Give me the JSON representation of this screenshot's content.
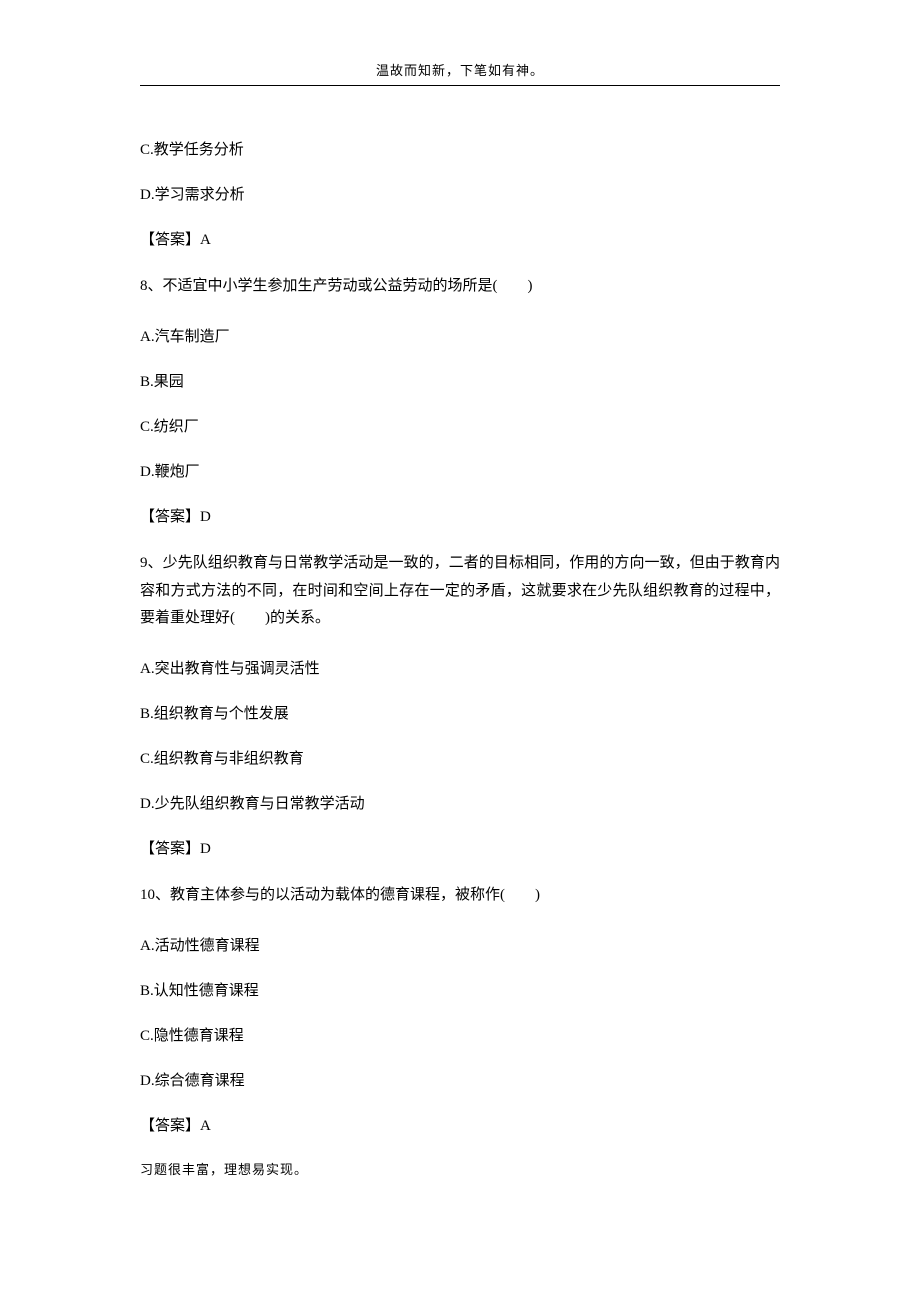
{
  "header": "温故而知新，下笔如有神。",
  "q7": {
    "optC": "C.教学任务分析",
    "optD": "D.学习需求分析",
    "answer": "【答案】A"
  },
  "q8": {
    "text": "8、不适宜中小学生参加生产劳动或公益劳动的场所是(　　)",
    "optA": "A.汽车制造厂",
    "optB": "B.果园",
    "optC": "C.纺织厂",
    "optD": "D.鞭炮厂",
    "answer": "【答案】D"
  },
  "q9": {
    "text": "9、少先队组织教育与日常教学活动是一致的，二者的目标相同，作用的方向一致，但由于教育内容和方式方法的不同，在时间和空间上存在一定的矛盾，这就要求在少先队组织教育的过程中，要着重处理好(　　)的关系。",
    "optA": "A.突出教育性与强调灵活性",
    "optB": "B.组织教育与个性发展",
    "optC": "C.组织教育与非组织教育",
    "optD": "D.少先队组织教育与日常教学活动",
    "answer": "【答案】D"
  },
  "q10": {
    "text": "10、教育主体参与的以活动为载体的德育课程，被称作(　　)",
    "optA": "A.活动性德育课程",
    "optB": "B.认知性德育课程",
    "optC": "C.隐性德育课程",
    "optD": "D.综合德育课程",
    "answer": "【答案】A"
  },
  "footer": "习题很丰富，理想易实现。"
}
